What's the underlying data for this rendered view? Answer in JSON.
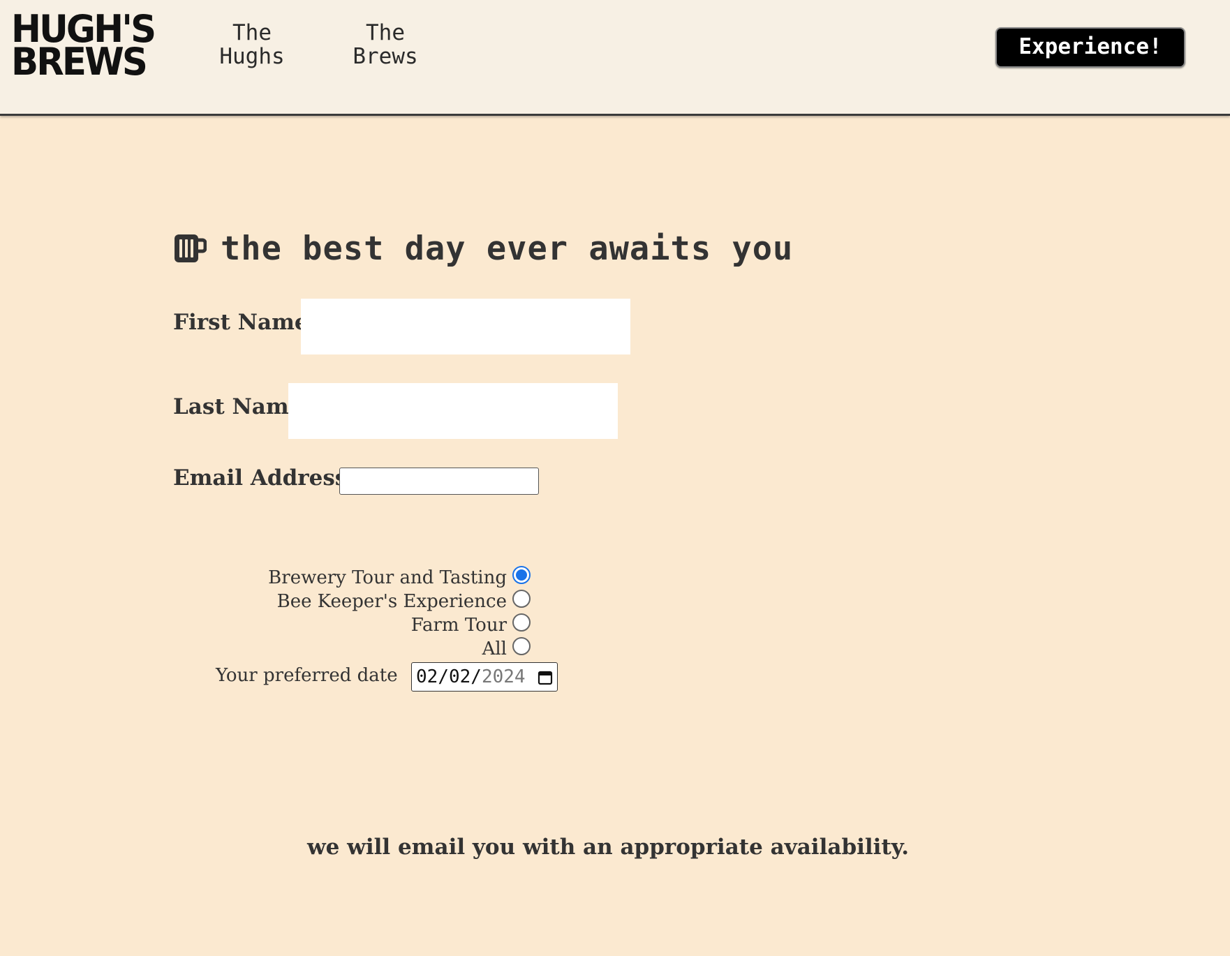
{
  "header": {
    "logo_line1": "HUGH'S",
    "logo_line2": "BREWS",
    "nav": [
      {
        "label": "The\nHughs"
      },
      {
        "label": "The\nBrews"
      }
    ],
    "cta_label": "Experience!"
  },
  "form": {
    "heading": "the best day ever awaits you",
    "heading_icon": "beer-mug-icon",
    "first_name_label": "First Name",
    "first_name_value": "",
    "last_name_label": "Last Name",
    "last_name_value": "",
    "email_label": "Email Address",
    "email_value": "",
    "experience_options": [
      {
        "label": "Brewery Tour and Tasting",
        "checked": true
      },
      {
        "label": "Bee Keeper's Experience",
        "checked": false
      },
      {
        "label": "Farm Tour",
        "checked": false
      },
      {
        "label": "All",
        "checked": false
      }
    ],
    "date_label": "Your preferred date",
    "date_month": "02",
    "date_day": "02",
    "date_year": "2024",
    "accent_color": "#1a73e8"
  },
  "footer_note": "we will email you with an appropriate availability.",
  "colors": {
    "page_background": "#fbe9d0",
    "header_background": "#f7f0e4",
    "cta_background": "#000000"
  }
}
